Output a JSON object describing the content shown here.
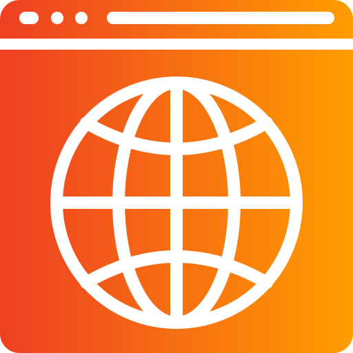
{
  "icon": {
    "name": "browser-globe-icon",
    "gradient_start": "#EE3F23",
    "gradient_end": "#FF9E00",
    "foreground": "#FFFFFF"
  },
  "window": {
    "controls": [
      "window-dot",
      "window-dot",
      "window-dot"
    ],
    "address_bar": ""
  }
}
